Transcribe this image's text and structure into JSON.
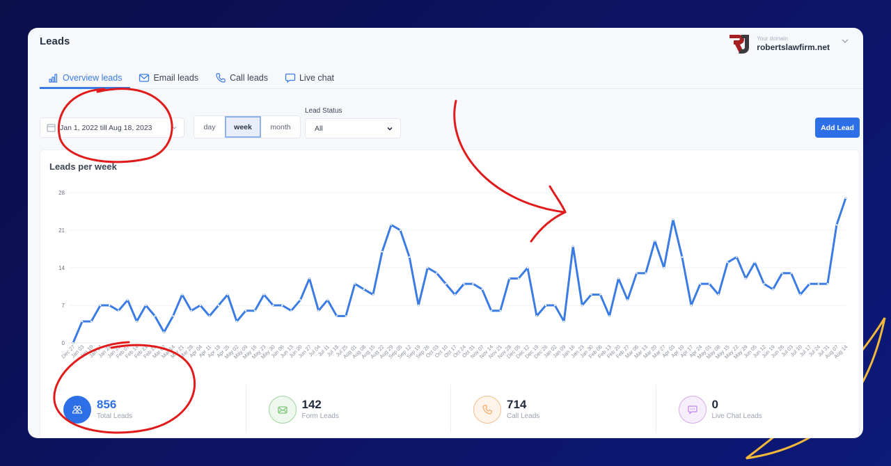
{
  "header": {
    "title": "Leads",
    "brand": {
      "logo_text": "RJ",
      "caption": "Your domain",
      "domain": "robertslawfirm.net"
    }
  },
  "tabs": [
    {
      "label": "Overview leads",
      "icon": "bar-chart-icon",
      "active": true
    },
    {
      "label": "Email leads",
      "icon": "envelope-icon",
      "active": false
    },
    {
      "label": "Call leads",
      "icon": "phone-icon",
      "active": false
    },
    {
      "label": "Live chat",
      "icon": "chat-bubble-icon",
      "active": false
    }
  ],
  "filters": {
    "date_range": "Jan 1, 2022 till Aug 18, 2023",
    "granularity": {
      "options": [
        "day",
        "week",
        "month"
      ],
      "selected": "week"
    },
    "lead_status": {
      "label": "Lead Status",
      "selected": "All"
    }
  },
  "actions": {
    "add_lead": "Add Lead"
  },
  "colors": {
    "accent": "#2c6fe6",
    "line": "#3b7be4",
    "form": "#7cc77a",
    "call": "#f3a866",
    "chat": "#c384e6",
    "annotation": "#e11b1b",
    "decoration": "#f2b83a"
  },
  "chart_data": {
    "type": "line",
    "title": "Leads per week",
    "xlabel": "",
    "ylabel": "",
    "ylim": [
      0,
      28
    ],
    "yticks": [
      0,
      7,
      14,
      21,
      28
    ],
    "grid": true,
    "legend": "none",
    "categories": [
      "Dec 27",
      "Jan 03",
      "Jan 10",
      "Jan 17",
      "Jan 24",
      "Jan 31",
      "Feb 07",
      "Feb 14",
      "Feb 21",
      "Feb 28",
      "Mar 07",
      "Mar 14",
      "Mar 21",
      "Mar 28",
      "Apr 04",
      "Apr 11",
      "Apr 18",
      "Apr 25",
      "May 02",
      "May 09",
      "May 16",
      "May 23",
      "May 30",
      "Jun 06",
      "Jun 13",
      "Jun 20",
      "Jun 27",
      "Jul 04",
      "Jul 11",
      "Jul 18",
      "Jul 25",
      "Aug 01",
      "Aug 08",
      "Aug 15",
      "Aug 22",
      "Aug 29",
      "Sep 05",
      "Sep 12",
      "Sep 19",
      "Sep 26",
      "Oct 03",
      "Oct 10",
      "Oct 17",
      "Oct 24",
      "Oct 31",
      "Nov 07",
      "Nov 14",
      "Nov 21",
      "Nov 28",
      "Dec 05",
      "Dec 12",
      "Dec 19",
      "Dec 26",
      "Jan 02",
      "Jan 09",
      "Jan 16",
      "Jan 23",
      "Jan 30",
      "Feb 06",
      "Feb 13",
      "Feb 20",
      "Feb 27",
      "Mar 06",
      "Mar 13",
      "Mar 20",
      "Mar 27",
      "Apr 03",
      "Apr 10",
      "Apr 17",
      "Apr 24",
      "May 01",
      "May 08",
      "May 15",
      "May 22",
      "May 29",
      "Jun 05",
      "Jun 12",
      "Jun 19",
      "Jun 26",
      "Jul 03",
      "Jul 10",
      "Jul 17",
      "Jul 24",
      "Jul 31",
      "Aug 07",
      "Aug 14"
    ],
    "series": [
      {
        "name": "Leads",
        "values": [
          0,
          4,
          4,
          7,
          7,
          6,
          8,
          4,
          7,
          5,
          2,
          5,
          9,
          6,
          7,
          5,
          7,
          9,
          4,
          6,
          6,
          9,
          7,
          7,
          6,
          8,
          12,
          6,
          8,
          5,
          5,
          11,
          10,
          9,
          17,
          22,
          21,
          16,
          7,
          14,
          13,
          11,
          9,
          11,
          11,
          10,
          6,
          6,
          12,
          12,
          14,
          5,
          7,
          7,
          4,
          18,
          7,
          9,
          9,
          5,
          12,
          8,
          13,
          13,
          19,
          14,
          23,
          16,
          7,
          11,
          11,
          9,
          15,
          16,
          12,
          15,
          11,
          10,
          13,
          13,
          9,
          11,
          11,
          11,
          22,
          27
        ]
      }
    ]
  },
  "stats": [
    {
      "value": "856",
      "label": "Total Leads",
      "icon": "users-icon"
    },
    {
      "value": "142",
      "label": "Form Leads",
      "icon": "envelope-icon"
    },
    {
      "value": "714",
      "label": "Call Leads",
      "icon": "phone-icon"
    },
    {
      "value": "0",
      "label": "Live Chat Leads",
      "icon": "chat-bubble-icon"
    }
  ]
}
